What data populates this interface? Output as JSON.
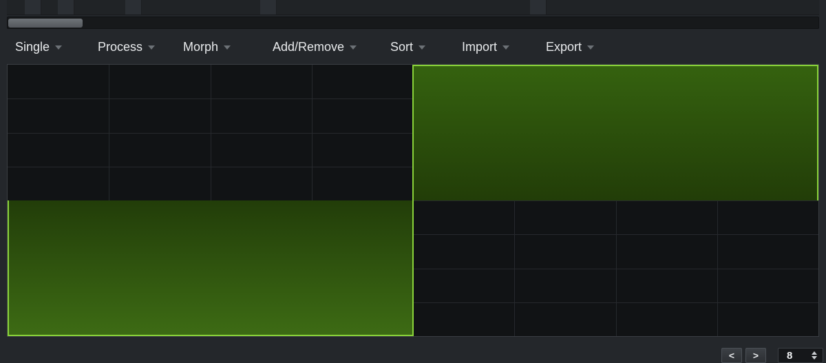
{
  "menu": {
    "items": [
      {
        "id": "single",
        "label": "Single"
      },
      {
        "id": "process",
        "label": "Process"
      },
      {
        "id": "morph",
        "label": "Morph"
      },
      {
        "id": "add-remove",
        "label": "Add/Remove"
      },
      {
        "id": "sort",
        "label": "Sort"
      },
      {
        "id": "import",
        "label": "Import"
      },
      {
        "id": "export",
        "label": "Export"
      }
    ]
  },
  "waveform": {
    "shape": "square",
    "high_level": 1.0,
    "low_level": -1.0,
    "transition_at": 0.5,
    "fill_color": "#2f5a0f",
    "stroke_color": "#8ad33a",
    "grid_columns": 8,
    "grid_rows": 8
  },
  "navigation": {
    "prev_icon": "chevron-left-icon",
    "next_icon": "chevron-right-icon",
    "prev_glyph": "<",
    "next_glyph": ">",
    "count_value": "8"
  }
}
